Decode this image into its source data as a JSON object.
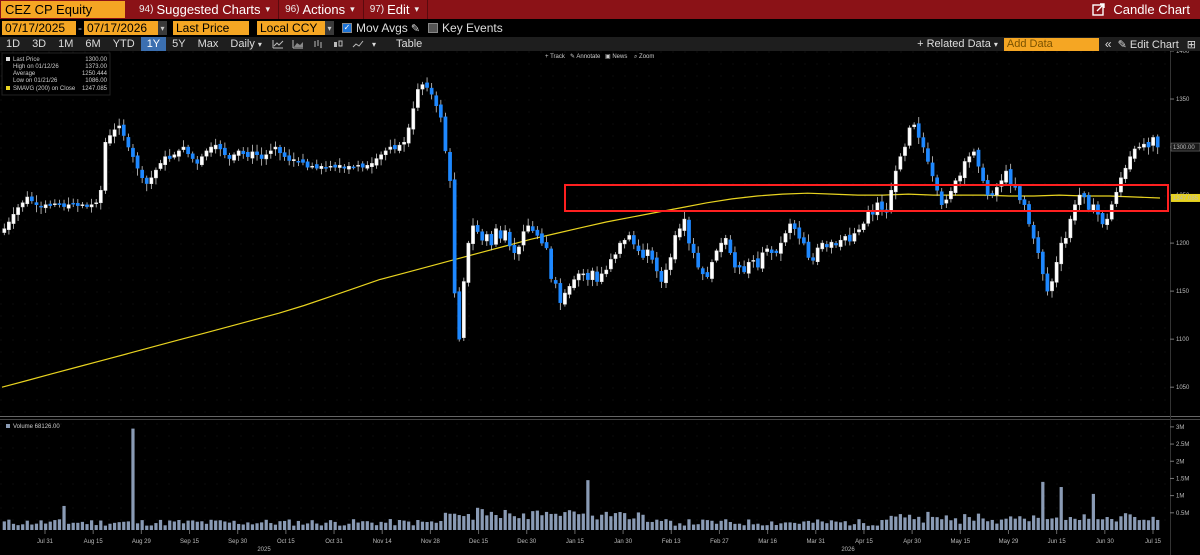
{
  "topbar": {
    "ticker": "CEZ CP Equity",
    "menus": [
      {
        "num": "94)",
        "label": "Suggested Charts"
      },
      {
        "num": "96)",
        "label": "Actions"
      },
      {
        "num": "97)",
        "label": "Edit"
      }
    ],
    "candle_label": "Candle Chart"
  },
  "controls": {
    "start_date": "07/17/2025",
    "end_date": "07/17/2026",
    "field": "Last Price",
    "currency": "Local CCY",
    "mov_avgs": "Mov Avgs",
    "key_events": "Key Events"
  },
  "range_bar": {
    "ranges": [
      "1D",
      "3D",
      "1M",
      "6M",
      "YTD",
      "1Y",
      "5Y",
      "Max"
    ],
    "active_range": "1Y",
    "frequency": "Daily",
    "table": "Table",
    "related_data": "+ Related Data",
    "add_data_placeholder": "Add Data",
    "edit_chart": "Edit Chart"
  },
  "chart_tools": [
    "Track",
    "Annotate",
    "News",
    "Zoom"
  ],
  "colors": {
    "up": "#ffffff",
    "down": "#1e88ff",
    "sma": "#e8d320",
    "highlight_box": "#ff2020",
    "accent": "#f5a623",
    "topbar": "#8b1217"
  },
  "legend": {
    "price": [
      {
        "label": "Last Price",
        "value": "1300.00"
      },
      {
        "label": "High on 01/12/26",
        "value": "1373.00"
      },
      {
        "label": "Average",
        "value": "1250.444"
      },
      {
        "label": "Low on 01/21/26",
        "value": "1086.00"
      },
      {
        "label": "SMAVG (200)  on Close",
        "value": "1247.085"
      }
    ],
    "volume": "Volume  68126.00"
  },
  "chart_data": [
    {
      "type": "candlestick",
      "ylim": [
        1020,
        1400
      ],
      "yticks": [
        1050,
        1100,
        1150,
        1200,
        1250,
        1300,
        1350,
        1400
      ],
      "x_tick_labels": [
        "Jul 31",
        "Aug 15",
        "Aug 29",
        "Sep 15",
        "Sep 30",
        "Oct 15",
        "Oct 31",
        "Nov 14",
        "Nov 28",
        "Dec 15",
        "Dec 30",
        "Jan 15",
        "Jan 30",
        "Feb 13",
        "Feb 27",
        "Mar 16",
        "Mar 31",
        "Apr 15",
        "Apr 30",
        "May 15",
        "May 29",
        "Jun 15",
        "Jun 30",
        "Jul 15"
      ],
      "year_labels": [
        "2025",
        "2026"
      ],
      "last_price_label": "1300.00",
      "sma_label": "1247.085",
      "close": [
        1215,
        1222,
        1230,
        1237,
        1242,
        1248,
        1244,
        1240,
        1238,
        1240,
        1239,
        1241,
        1240,
        1238,
        1240,
        1241,
        1239,
        1240,
        1238,
        1240,
        1242,
        1255,
        1305,
        1312,
        1318,
        1322,
        1312,
        1300,
        1290,
        1278,
        1268,
        1262,
        1268,
        1276,
        1283,
        1290,
        1288,
        1292,
        1296,
        1300,
        1293,
        1288,
        1283,
        1290,
        1296,
        1300,
        1302,
        1298,
        1292,
        1288,
        1292,
        1296,
        1293,
        1290,
        1295,
        1292,
        1288,
        1292,
        1296,
        1300,
        1294,
        1290,
        1286,
        1287,
        1285,
        1284,
        1279,
        1280,
        1278,
        1280,
        1278,
        1280,
        1279,
        1281,
        1278,
        1280,
        1279,
        1281,
        1279,
        1281,
        1283,
        1288,
        1292,
        1296,
        1300,
        1298,
        1302,
        1305,
        1320,
        1340,
        1360,
        1365,
        1362,
        1355,
        1343,
        1331,
        1296,
        1265,
        1148,
        1100,
        1160,
        1200,
        1218,
        1212,
        1203,
        1209,
        1198,
        1215,
        1205,
        1213,
        1197,
        1190,
        1196,
        1212,
        1218,
        1213,
        1208,
        1200,
        1195,
        1163,
        1158,
        1138,
        1148,
        1155,
        1162,
        1168,
        1168,
        1162,
        1171,
        1160,
        1168,
        1172,
        1183,
        1188,
        1200,
        1203,
        1208,
        1199,
        1192,
        1185,
        1193,
        1183,
        1171,
        1160,
        1172,
        1185,
        1208,
        1215,
        1225,
        1200,
        1190,
        1175,
        1168,
        1165,
        1180,
        1192,
        1200,
        1205,
        1190,
        1175,
        1175,
        1170,
        1180,
        1182,
        1175,
        1190,
        1194,
        1190,
        1190,
        1200,
        1210,
        1220,
        1215,
        1205,
        1200,
        1185,
        1182,
        1195,
        1200,
        1196,
        1201,
        1198,
        1203,
        1207,
        1202,
        1210,
        1214,
        1220,
        1233,
        1230,
        1242,
        1235,
        1232,
        1255,
        1275,
        1290,
        1300,
        1320,
        1323,
        1310,
        1300,
        1285,
        1270,
        1255,
        1240,
        1245,
        1254,
        1265,
        1270,
        1285,
        1290,
        1295,
        1280,
        1265,
        1250,
        1250,
        1258,
        1265,
        1275,
        1260,
        1258,
        1245,
        1240,
        1220,
        1205,
        1190,
        1168,
        1150,
        1160,
        1180,
        1200,
        1205,
        1225,
        1240,
        1250,
        1248,
        1235,
        1240,
        1230,
        1220,
        1225,
        1240,
        1253,
        1268,
        1278,
        1290,
        1298,
        1300,
        1303,
        1300,
        1310,
        1300
      ]
    },
    {
      "type": "line",
      "name": "SMAVG (200) on Close",
      "values": [
        1050,
        1057,
        1064,
        1071,
        1078,
        1085,
        1092,
        1099,
        1106,
        1113,
        1120,
        1127,
        1135,
        1144,
        1153,
        1162,
        1169,
        1176,
        1183,
        1190,
        1197,
        1204,
        1210,
        1216,
        1222,
        1227,
        1232,
        1237,
        1242,
        1246,
        1249,
        1251,
        1252,
        1251,
        1250,
        1250,
        1251,
        1250,
        1250,
        1250,
        1249,
        1249,
        1250,
        1249,
        1249,
        1248,
        1247
      ]
    },
    {
      "type": "bar",
      "name": "Volume",
      "ylim": [
        0,
        3200000
      ],
      "yticks": [
        "0.5M",
        "1M",
        "1.5M",
        "2M",
        "2.5M",
        "3M"
      ],
      "last_value": "68126.00",
      "spikes": [
        {
          "x": "Jul 31",
          "value": 700000
        },
        {
          "x": "Aug 29",
          "value": 2950000
        },
        {
          "x": "Jan 15",
          "value": 1450000
        },
        {
          "x": "Jun 10",
          "value": 1400000
        },
        {
          "x": "Jun 18",
          "value": 1250000
        },
        {
          "x": "Jul 1",
          "value": 1050000
        }
      ]
    }
  ]
}
